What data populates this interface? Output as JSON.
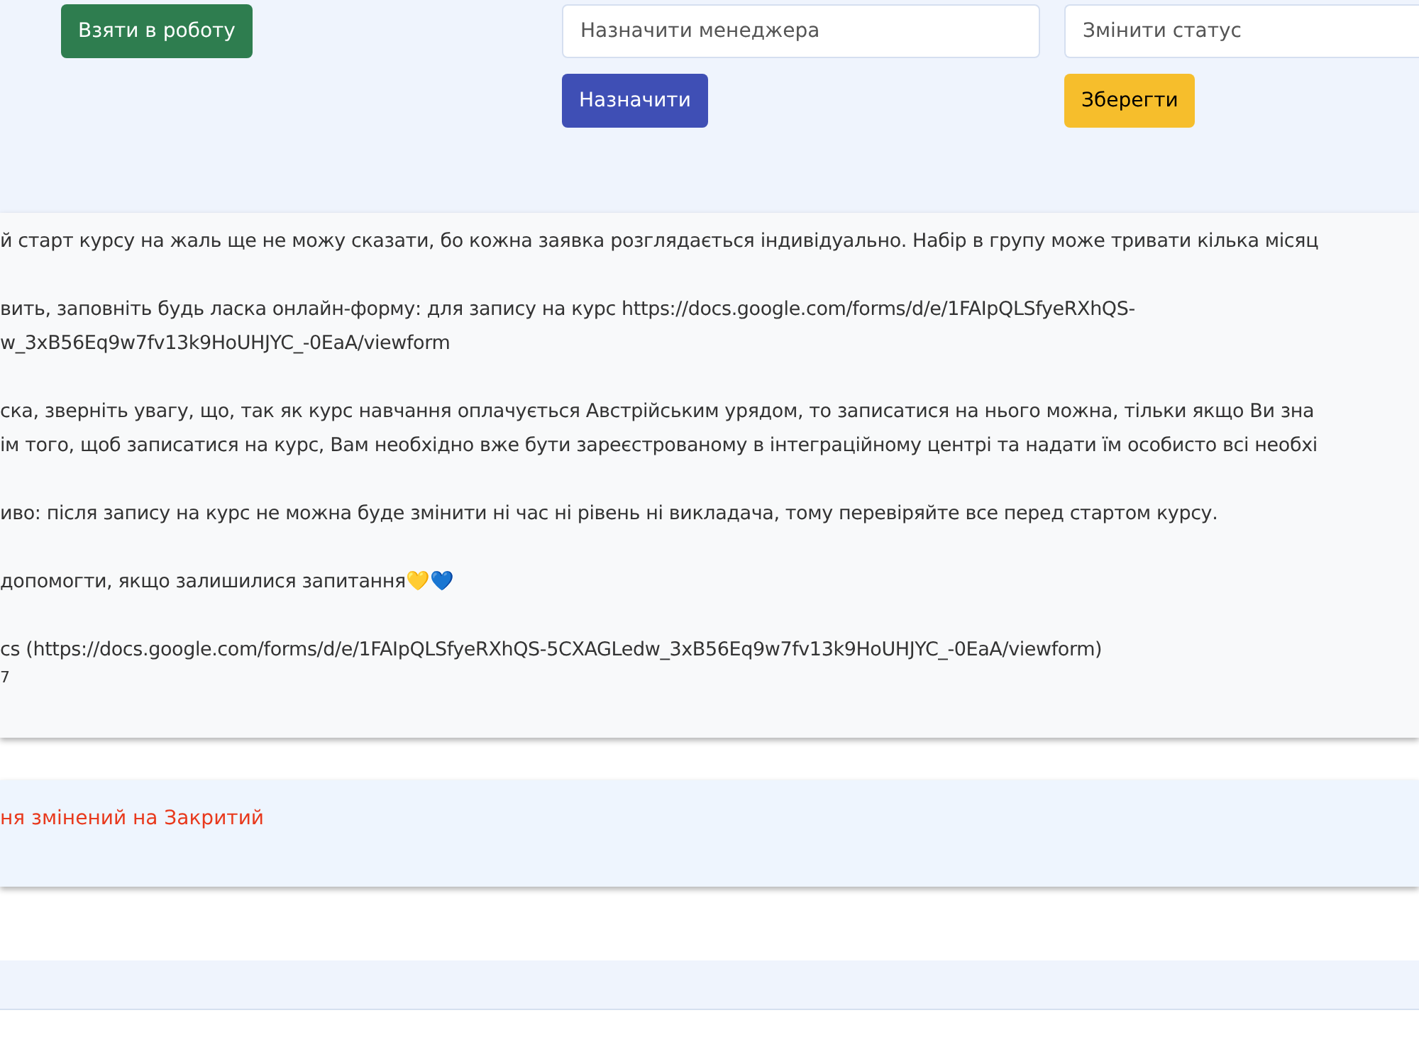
{
  "actions": {
    "take_button": "Взяти в роботу",
    "manager_field": {
      "placeholder": "Назначити менеджера"
    },
    "assign_button": "Назначити",
    "status_field": {
      "placeholder": "Змінити статус"
    },
    "save_button": "Зберегти"
  },
  "message": {
    "paragraphs": [
      [
        "й старт курсу на жаль ще не можу сказати, бо кожна заявка розглядається індивідуально. Набір в групу може тривати кілька місяц"
      ],
      [
        "вить, заповніть будь ласка онлайн-форму: для запису на курс https://docs.google.com/forms/d/e/1FAIpQLSfyeRXhQS-",
        "w_3xB56Eq9w7fv13k9HoUHJYC_-0EaA/viewform"
      ],
      [
        "ска, зверніть увагу, що, так як курс навчання оплачується Австрійським урядом, то записатися на нього можна, тільки якщо Ви зна",
        "ім того, щоб записатися на курс, Вам необхідно вже бути зареєстрованому в інтеграційному центрі та надати їм особисто всі необхі"
      ],
      [
        "иво: після запису на курс не можна буде змінити ні час ні рівень ні викладача, тому перевіряйте все перед стартом курсу."
      ],
      [
        "допомогти, якщо залишилися запитання💛💙"
      ],
      [
        "cs (https://docs.google.com/forms/d/e/1FAIpQLSfyeRXhQS-5CXAGLedw_3xB56Eq9w7fv13k9HoUHJYC_-0EaA/viewform)"
      ]
    ],
    "time": "7"
  },
  "status_note": "ня змінений на Закритий"
}
